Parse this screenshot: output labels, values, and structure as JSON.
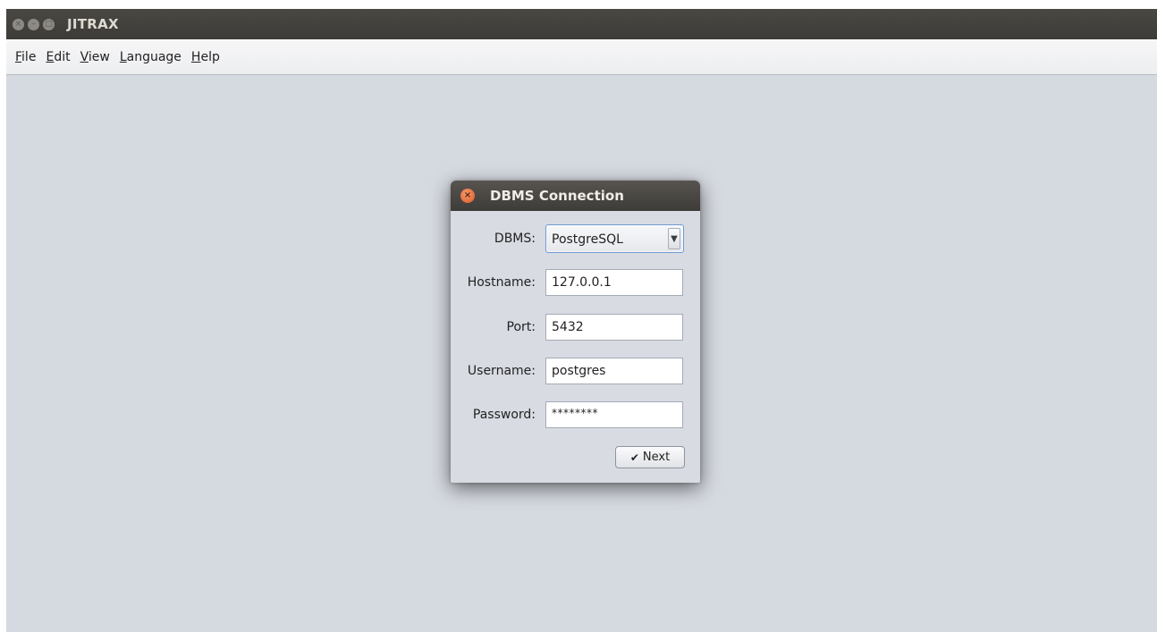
{
  "window": {
    "title": "JITRAX",
    "controls": [
      {
        "icon": "close-icon",
        "glyph": "×"
      },
      {
        "icon": "minimize-icon",
        "glyph": "–"
      },
      {
        "icon": "maximize-icon",
        "glyph": "□"
      }
    ]
  },
  "menubar": {
    "items": [
      {
        "mnemonic": "F",
        "rest": "ile"
      },
      {
        "mnemonic": "E",
        "rest": "dit"
      },
      {
        "mnemonic": "V",
        "rest": "iew"
      },
      {
        "mnemonic": "L",
        "rest": "anguage"
      },
      {
        "mnemonic": "H",
        "rest": "elp"
      }
    ]
  },
  "dialog": {
    "title": "DBMS Connection",
    "close_glyph": "×",
    "fields": {
      "dbms": {
        "label": "DBMS:",
        "value": "PostgreSQL",
        "arrow": "▼"
      },
      "hostname": {
        "label": "Hostname:",
        "value": "127.0.0.1"
      },
      "port": {
        "label": "Port:",
        "value": "5432"
      },
      "username": {
        "label": "Username:",
        "value": "postgres"
      },
      "password": {
        "label": "Password:",
        "value": "********"
      }
    },
    "next_button": {
      "icon": "check-icon",
      "glyph": "✔",
      "label": "Next"
    }
  },
  "colors": {
    "titlebar": "#3d3b37",
    "workspace": "#d5d9e0",
    "close_button": "#df5a26",
    "focus_border": "#6f9ad1"
  }
}
